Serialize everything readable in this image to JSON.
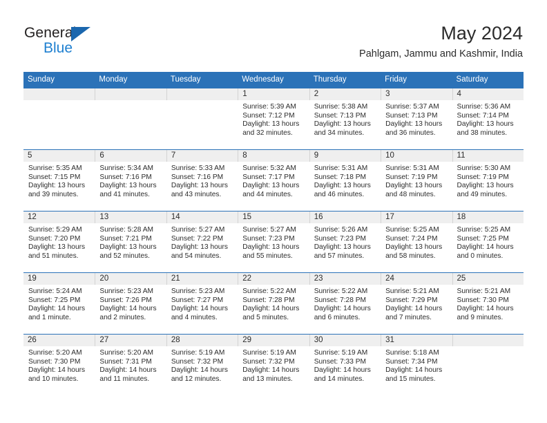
{
  "brand": {
    "name_part1": "General",
    "name_part2": "Blue",
    "triangle_color": "#1b67ae",
    "blue_color": "#1d7fd0"
  },
  "header": {
    "month_title": "May 2024",
    "location": "Pahlgam, Jammu and Kashmir, India"
  },
  "theme": {
    "header_bg": "#2b72b8",
    "daynum_bg": "#efefef",
    "text_color": "#2b2b2b"
  },
  "weekdays": [
    "Sunday",
    "Monday",
    "Tuesday",
    "Wednesday",
    "Thursday",
    "Friday",
    "Saturday"
  ],
  "weeks": [
    [
      {
        "day": "",
        "blank": true
      },
      {
        "day": "",
        "blank": true
      },
      {
        "day": "",
        "blank": true
      },
      {
        "day": "1",
        "sunrise": "Sunrise: 5:39 AM",
        "sunset": "Sunset: 7:12 PM",
        "daylight1": "Daylight: 13 hours",
        "daylight2": "and 32 minutes."
      },
      {
        "day": "2",
        "sunrise": "Sunrise: 5:38 AM",
        "sunset": "Sunset: 7:13 PM",
        "daylight1": "Daylight: 13 hours",
        "daylight2": "and 34 minutes."
      },
      {
        "day": "3",
        "sunrise": "Sunrise: 5:37 AM",
        "sunset": "Sunset: 7:13 PM",
        "daylight1": "Daylight: 13 hours",
        "daylight2": "and 36 minutes."
      },
      {
        "day": "4",
        "sunrise": "Sunrise: 5:36 AM",
        "sunset": "Sunset: 7:14 PM",
        "daylight1": "Daylight: 13 hours",
        "daylight2": "and 38 minutes."
      }
    ],
    [
      {
        "day": "5",
        "sunrise": "Sunrise: 5:35 AM",
        "sunset": "Sunset: 7:15 PM",
        "daylight1": "Daylight: 13 hours",
        "daylight2": "and 39 minutes."
      },
      {
        "day": "6",
        "sunrise": "Sunrise: 5:34 AM",
        "sunset": "Sunset: 7:16 PM",
        "daylight1": "Daylight: 13 hours",
        "daylight2": "and 41 minutes."
      },
      {
        "day": "7",
        "sunrise": "Sunrise: 5:33 AM",
        "sunset": "Sunset: 7:16 PM",
        "daylight1": "Daylight: 13 hours",
        "daylight2": "and 43 minutes."
      },
      {
        "day": "8",
        "sunrise": "Sunrise: 5:32 AM",
        "sunset": "Sunset: 7:17 PM",
        "daylight1": "Daylight: 13 hours",
        "daylight2": "and 44 minutes."
      },
      {
        "day": "9",
        "sunrise": "Sunrise: 5:31 AM",
        "sunset": "Sunset: 7:18 PM",
        "daylight1": "Daylight: 13 hours",
        "daylight2": "and 46 minutes."
      },
      {
        "day": "10",
        "sunrise": "Sunrise: 5:31 AM",
        "sunset": "Sunset: 7:19 PM",
        "daylight1": "Daylight: 13 hours",
        "daylight2": "and 48 minutes."
      },
      {
        "day": "11",
        "sunrise": "Sunrise: 5:30 AM",
        "sunset": "Sunset: 7:19 PM",
        "daylight1": "Daylight: 13 hours",
        "daylight2": "and 49 minutes."
      }
    ],
    [
      {
        "day": "12",
        "sunrise": "Sunrise: 5:29 AM",
        "sunset": "Sunset: 7:20 PM",
        "daylight1": "Daylight: 13 hours",
        "daylight2": "and 51 minutes."
      },
      {
        "day": "13",
        "sunrise": "Sunrise: 5:28 AM",
        "sunset": "Sunset: 7:21 PM",
        "daylight1": "Daylight: 13 hours",
        "daylight2": "and 52 minutes."
      },
      {
        "day": "14",
        "sunrise": "Sunrise: 5:27 AM",
        "sunset": "Sunset: 7:22 PM",
        "daylight1": "Daylight: 13 hours",
        "daylight2": "and 54 minutes."
      },
      {
        "day": "15",
        "sunrise": "Sunrise: 5:27 AM",
        "sunset": "Sunset: 7:23 PM",
        "daylight1": "Daylight: 13 hours",
        "daylight2": "and 55 minutes."
      },
      {
        "day": "16",
        "sunrise": "Sunrise: 5:26 AM",
        "sunset": "Sunset: 7:23 PM",
        "daylight1": "Daylight: 13 hours",
        "daylight2": "and 57 minutes."
      },
      {
        "day": "17",
        "sunrise": "Sunrise: 5:25 AM",
        "sunset": "Sunset: 7:24 PM",
        "daylight1": "Daylight: 13 hours",
        "daylight2": "and 58 minutes."
      },
      {
        "day": "18",
        "sunrise": "Sunrise: 5:25 AM",
        "sunset": "Sunset: 7:25 PM",
        "daylight1": "Daylight: 14 hours",
        "daylight2": "and 0 minutes."
      }
    ],
    [
      {
        "day": "19",
        "sunrise": "Sunrise: 5:24 AM",
        "sunset": "Sunset: 7:25 PM",
        "daylight1": "Daylight: 14 hours",
        "daylight2": "and 1 minute."
      },
      {
        "day": "20",
        "sunrise": "Sunrise: 5:23 AM",
        "sunset": "Sunset: 7:26 PM",
        "daylight1": "Daylight: 14 hours",
        "daylight2": "and 2 minutes."
      },
      {
        "day": "21",
        "sunrise": "Sunrise: 5:23 AM",
        "sunset": "Sunset: 7:27 PM",
        "daylight1": "Daylight: 14 hours",
        "daylight2": "and 4 minutes."
      },
      {
        "day": "22",
        "sunrise": "Sunrise: 5:22 AM",
        "sunset": "Sunset: 7:28 PM",
        "daylight1": "Daylight: 14 hours",
        "daylight2": "and 5 minutes."
      },
      {
        "day": "23",
        "sunrise": "Sunrise: 5:22 AM",
        "sunset": "Sunset: 7:28 PM",
        "daylight1": "Daylight: 14 hours",
        "daylight2": "and 6 minutes."
      },
      {
        "day": "24",
        "sunrise": "Sunrise: 5:21 AM",
        "sunset": "Sunset: 7:29 PM",
        "daylight1": "Daylight: 14 hours",
        "daylight2": "and 7 minutes."
      },
      {
        "day": "25",
        "sunrise": "Sunrise: 5:21 AM",
        "sunset": "Sunset: 7:30 PM",
        "daylight1": "Daylight: 14 hours",
        "daylight2": "and 9 minutes."
      }
    ],
    [
      {
        "day": "26",
        "sunrise": "Sunrise: 5:20 AM",
        "sunset": "Sunset: 7:30 PM",
        "daylight1": "Daylight: 14 hours",
        "daylight2": "and 10 minutes."
      },
      {
        "day": "27",
        "sunrise": "Sunrise: 5:20 AM",
        "sunset": "Sunset: 7:31 PM",
        "daylight1": "Daylight: 14 hours",
        "daylight2": "and 11 minutes."
      },
      {
        "day": "28",
        "sunrise": "Sunrise: 5:19 AM",
        "sunset": "Sunset: 7:32 PM",
        "daylight1": "Daylight: 14 hours",
        "daylight2": "and 12 minutes."
      },
      {
        "day": "29",
        "sunrise": "Sunrise: 5:19 AM",
        "sunset": "Sunset: 7:32 PM",
        "daylight1": "Daylight: 14 hours",
        "daylight2": "and 13 minutes."
      },
      {
        "day": "30",
        "sunrise": "Sunrise: 5:19 AM",
        "sunset": "Sunset: 7:33 PM",
        "daylight1": "Daylight: 14 hours",
        "daylight2": "and 14 minutes."
      },
      {
        "day": "31",
        "sunrise": "Sunrise: 5:18 AM",
        "sunset": "Sunset: 7:34 PM",
        "daylight1": "Daylight: 14 hours",
        "daylight2": "and 15 minutes."
      },
      {
        "day": "",
        "blank": true
      }
    ]
  ]
}
